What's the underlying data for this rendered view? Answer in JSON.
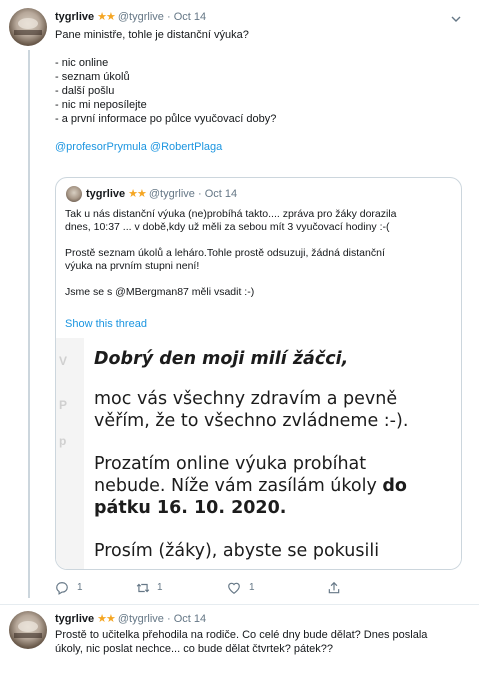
{
  "tweet1": {
    "name": "tygrlive",
    "stars": "★★",
    "handle": "@tygrlive",
    "dot": "·",
    "date": "Oct 14",
    "lines": [
      "Pane ministře, tohle je distanční výuka?",
      "",
      "- nic online",
      "- seznam úkolů",
      "- další pošlu",
      "- nic mi neposílejte",
      "- a první informace po půlce vyučovací doby?",
      ""
    ],
    "mentions": "@profesorPrymula @RobertPlaga",
    "quote": {
      "name": "tygrlive",
      "stars": "★★",
      "handle": "@tygrlive",
      "dot": "·",
      "date": "Oct 14",
      "lines": [
        "Tak u nás distanční výuka (ne)probíhá takto.... zpráva pro žáky dorazila",
        "dnes, 10:37 ... v době,kdy už měli za sebou mít 3 vyučovací hodiny :-(",
        "",
        "Prostě seznam úkolů a leháro.Tohle prostě odsuzuji, žádná distanční",
        "výuka na prvním stupni není!",
        "",
        "Jsme se s @MBergman87 měli vsadit :-)"
      ],
      "show_thread": "Show this thread",
      "image_text": {
        "line1": "Dobrý den moji milí žáčci,",
        "line2": "moc vás všechny zdravím a pevně",
        "line3": "věřím, že to všechno zvládneme :-).",
        "line4": "Prozatím online výuka probíhat",
        "line5a": "nebude. Níže vám zasílám úkoly ",
        "line5b": "do",
        "line6": "pátku 16. 10. 2020.",
        "line7": "Prosím (žáky), abyste se  pokusili",
        "ghost1": "V",
        "ghost2": "P",
        "ghost3": "p"
      }
    },
    "actions": {
      "reply": "1",
      "retweet": "1",
      "like": "1"
    }
  },
  "tweet2": {
    "name": "tygrlive",
    "stars": "★★",
    "handle": "@tygrlive",
    "dot": "·",
    "date": "Oct 14",
    "lines": [
      "Prostě to učitelka přehodila na rodiče. Co celé dny bude dělat? Dnes poslala",
      "úkoly, nic poslat nechce... co bude dělat čtvrtek? pátek??"
    ]
  },
  "colors": {
    "link": "#1b95e0",
    "star": "#f5a623",
    "muted": "#657786",
    "border": "#ccd6dd"
  },
  "icons": [
    "reply-icon",
    "retweet-icon",
    "like-icon",
    "share-icon",
    "chevron-down-icon"
  ]
}
